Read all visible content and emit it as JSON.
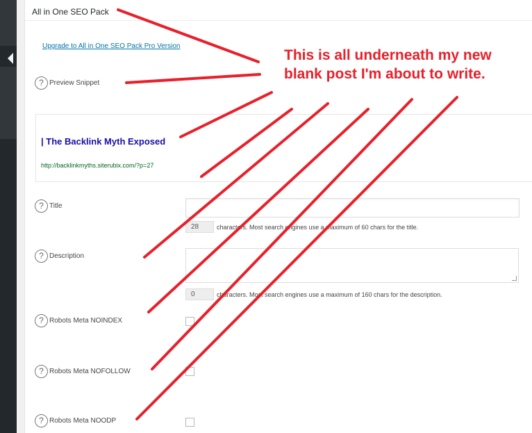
{
  "panel": {
    "title": "All in One SEO Pack",
    "upgrade_link": "Upgrade to All in One SEO Pack Pro Version"
  },
  "help_glyph": "?",
  "preview": {
    "label": "Preview Snippet",
    "snippet_title": "| The Backlink Myth Exposed",
    "snippet_url": "http://backlinkmyths.siterubix.com/?p=27"
  },
  "title_field": {
    "label": "Title",
    "value": "",
    "count": "28",
    "note": "characters. Most search engines use a maximum of 60 chars for the title."
  },
  "description_field": {
    "label": "Description",
    "value": "",
    "count": "0",
    "note": "characters. Most search engines use a maximum of 160 chars for the description."
  },
  "robots": [
    {
      "label": "Robots Meta NOINDEX",
      "checked": false
    },
    {
      "label": "Robots Meta NOFOLLOW",
      "checked": false
    },
    {
      "label": "Robots Meta NOODP",
      "checked": false
    }
  ],
  "annotation": {
    "text": "This is all underneath my new blank post I'm about to write.",
    "color": "#e8202a"
  },
  "colors": {
    "link": "#0073aa",
    "snippet_title": "#1a0dab",
    "snippet_url": "#006621",
    "admin_bar": "#23282d"
  }
}
